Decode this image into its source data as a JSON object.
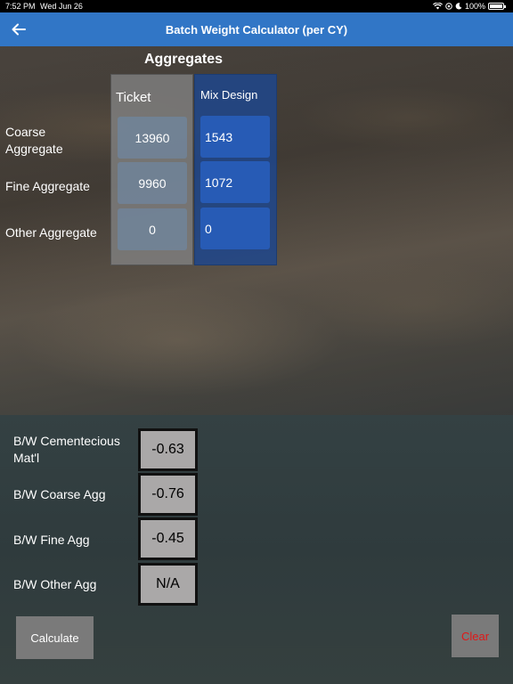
{
  "status_bar": {
    "time": "7:52 PM",
    "date": "Wed Jun 26",
    "battery": "100%"
  },
  "nav": {
    "title": "Batch Weight Calculator (per CY)",
    "back_icon": "arrow-left-icon"
  },
  "aggregates": {
    "title": "Aggregates",
    "ticket_header": "Ticket",
    "mix_header": "Mix Design",
    "rows": [
      {
        "label": "Coarse Aggregate",
        "ticket": "13960",
        "mix": "1543"
      },
      {
        "label": "Fine Aggregate",
        "ticket": "9960",
        "mix": "1072"
      },
      {
        "label": "Other Aggregate",
        "ticket": "0",
        "mix": "0"
      }
    ]
  },
  "results": [
    {
      "label": "B/W Cementecious Mat'l",
      "value": "-0.63"
    },
    {
      "label": "B/W Coarse Agg",
      "value": "-0.76"
    },
    {
      "label": "B/W Fine Agg",
      "value": "-0.45"
    },
    {
      "label": "B/W Other Agg",
      "value": "N/A"
    }
  ],
  "buttons": {
    "calculate": "Calculate",
    "clear": "Clear"
  },
  "colors": {
    "nav_bar": "#3176c6",
    "clear_text": "#e01818",
    "mix_column": "#1e468c"
  }
}
